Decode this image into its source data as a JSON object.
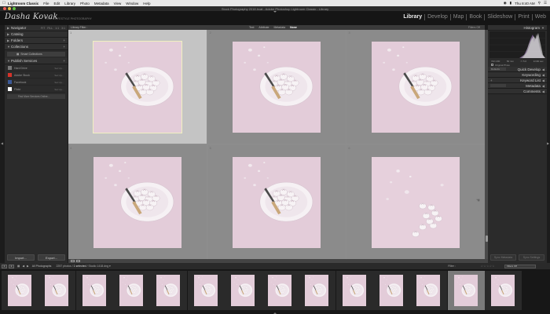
{
  "menubar": {
    "app_name": "Lightroom Classic",
    "items": [
      "File",
      "Edit",
      "Library",
      "Photo",
      "Metadata",
      "View",
      "Window",
      "Help"
    ],
    "clock": "Thu 8:40 AM"
  },
  "window": {
    "title": "Stock Photography 2018.lrcat - Adobe Photoshop Lightroom Classic - Library"
  },
  "identity": {
    "name": "Dasha Kovak",
    "sub": "FINE & LIFESTYLE PHOTOGRAPHY"
  },
  "modules": [
    "Library",
    "Develop",
    "Map",
    "Book",
    "Slideshow",
    "Print",
    "Web"
  ],
  "active_module": "Library",
  "left_panel": {
    "navigator": {
      "label": "Navigator",
      "options": [
        "FIT",
        "FILL",
        "1:1",
        "3:1"
      ]
    },
    "catalog": "Catalog",
    "folders": "Folders",
    "collections": "Collections",
    "smart_collections": "Smart Collections",
    "publish_services": "Publish Services",
    "services": [
      {
        "name": "Hard Drive",
        "setup": "Set Up...",
        "color": "#777777"
      },
      {
        "name": "Adobe Stock",
        "setup": "Set Up...",
        "color": "#d6332a"
      },
      {
        "name": "Facebook",
        "setup": "Set Up...",
        "color": "#3b5998"
      },
      {
        "name": "Flickr",
        "setup": "Set Up...",
        "color": "#ffffff"
      }
    ],
    "find_more": "Find More Services Online...",
    "import_label": "Import...",
    "export_label": "Export..."
  },
  "filter_bar": {
    "label": "Library Filter :",
    "tabs": [
      "Text",
      "Attribute",
      "Metadata",
      "None"
    ],
    "active_tab": "None",
    "right": "Filters Off"
  },
  "grid": {
    "columns": 3,
    "rows": 2,
    "selected_index": 0,
    "cells": [
      {
        "num": "1",
        "kind": "plate"
      },
      {
        "num": "2",
        "kind": "plate"
      },
      {
        "num": "3",
        "kind": "plate"
      },
      {
        "num": "4",
        "kind": "plate"
      },
      {
        "num": "5",
        "kind": "plate"
      },
      {
        "num": "6",
        "kind": "scatter"
      }
    ]
  },
  "right_panel": {
    "histogram": "Histogram",
    "exif": [
      "ISO 200",
      "50 mm",
      "f / 5.0",
      "1/160 sec"
    ],
    "original_photo": "Original Photo",
    "preset_label": "Defaults",
    "sections": [
      "Quick Develop",
      "Keywording",
      "Keyword List",
      "Metadata",
      "Comments"
    ],
    "sync_metadata": "Sync Metadata",
    "sync_settings": "Sync Settings"
  },
  "filmstrip": {
    "view_buttons": [
      "1",
      "2"
    ],
    "source": "All Photographs",
    "count": "2257 photos",
    "selected_info": "1 selected",
    "filename": "Studio 1418.dng",
    "filter_label": "Filter :",
    "filter_value": "Filters Off",
    "selected_thumb": 12,
    "thumb_count": 14
  },
  "colors": {
    "bg_dark": "#1a1a1a",
    "panel": "#2b2b2b",
    "grid": "#8d8d8d",
    "selected_cell": "#c4c4c4",
    "photo_pink": "#e0c8d6"
  }
}
